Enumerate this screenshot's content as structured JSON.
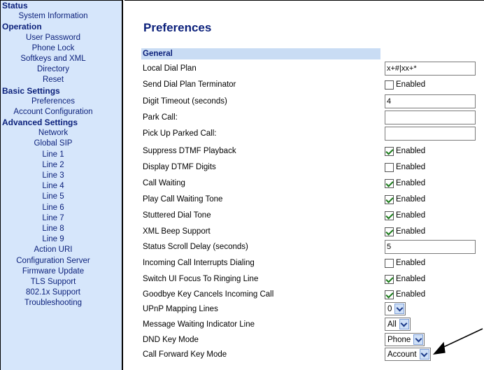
{
  "sidebar": {
    "sections": [
      {
        "title": "Status",
        "items": [
          "System Information"
        ]
      },
      {
        "title": "Operation",
        "items": [
          "User Password",
          "Phone Lock",
          "Softkeys and XML",
          "Directory",
          "Reset"
        ]
      },
      {
        "title": "Basic Settings",
        "items": [
          "Preferences",
          "Account Configuration"
        ]
      },
      {
        "title": "Advanced Settings",
        "items": [
          "Network",
          "Global SIP",
          "Line 1",
          "Line 2",
          "Line 3",
          "Line 4",
          "Line 5",
          "Line 6",
          "Line 7",
          "Line 8",
          "Line 9",
          "Action URI",
          "Configuration Server",
          "Firmware Update",
          "TLS Support",
          "802.1x Support",
          "Troubleshooting"
        ]
      }
    ]
  },
  "main": {
    "title": "Preferences",
    "section_header": "General",
    "rows": [
      {
        "label": "Local Dial Plan",
        "type": "text",
        "value": "x+#|xx+*"
      },
      {
        "label": "Send Dial Plan Terminator",
        "type": "checkbox",
        "checked": false,
        "check_label": "Enabled"
      },
      {
        "label": "Digit Timeout (seconds)",
        "type": "text",
        "value": "4"
      },
      {
        "label": "Park Call:",
        "type": "text",
        "value": ""
      },
      {
        "label": "Pick Up Parked Call:",
        "type": "text",
        "value": ""
      },
      {
        "label": "Suppress DTMF Playback",
        "type": "checkbox",
        "checked": true,
        "check_label": "Enabled"
      },
      {
        "label": "Display DTMF Digits",
        "type": "checkbox",
        "checked": false,
        "check_label": "Enabled"
      },
      {
        "label": "Call Waiting",
        "type": "checkbox",
        "checked": true,
        "check_label": "Enabled"
      },
      {
        "label": "Play Call Waiting Tone",
        "type": "checkbox",
        "checked": true,
        "check_label": "Enabled"
      },
      {
        "label": "Stuttered Dial Tone",
        "type": "checkbox",
        "checked": true,
        "check_label": "Enabled"
      },
      {
        "label": "XML Beep Support",
        "type": "checkbox",
        "checked": true,
        "check_label": "Enabled"
      },
      {
        "label": "Status Scroll Delay (seconds)",
        "type": "text",
        "value": "5"
      },
      {
        "label": "Incoming Call Interrupts Dialing",
        "type": "checkbox",
        "checked": false,
        "check_label": "Enabled"
      },
      {
        "label": "Switch UI Focus To Ringing Line",
        "type": "checkbox",
        "checked": true,
        "check_label": "Enabled"
      },
      {
        "label": "Goodbye Key Cancels Incoming Call",
        "type": "checkbox",
        "checked": true,
        "check_label": "Enabled"
      },
      {
        "label": "UPnP Mapping Lines",
        "type": "select",
        "value": "0"
      },
      {
        "label": "Message Waiting Indicator Line",
        "type": "select",
        "value": "All"
      },
      {
        "label": "DND Key Mode",
        "type": "select",
        "value": "Phone"
      },
      {
        "label": "Call Forward Key Mode",
        "type": "select",
        "value": "Account"
      }
    ]
  },
  "colors": {
    "sidebar_bg": "#d6e6fb",
    "nav_text": "#0a1f7a",
    "section_bg": "#c9dcf4",
    "check": "#1a7a1a"
  },
  "icons": {
    "checkbox": "checkmark-icon",
    "select": "chevron-down-icon",
    "callout": "arrow-icon"
  }
}
